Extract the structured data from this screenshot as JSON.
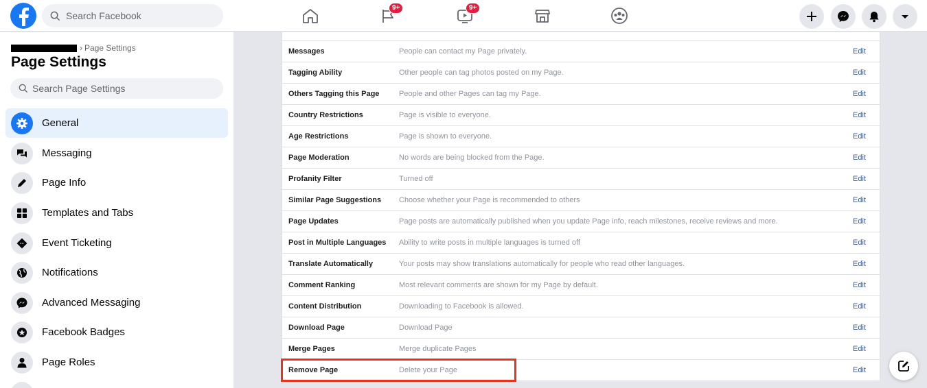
{
  "topbar": {
    "search_placeholder": "Search Facebook",
    "nav": [
      {
        "name": "home",
        "badge": ""
      },
      {
        "name": "pages",
        "badge": "9+"
      },
      {
        "name": "watch",
        "badge": "9+"
      },
      {
        "name": "marketplace",
        "badge": ""
      },
      {
        "name": "groups",
        "badge": ""
      }
    ]
  },
  "sidebar": {
    "breadcrumb": "Page Settings",
    "title": "Page Settings",
    "search_placeholder": "Search Page Settings",
    "items": [
      {
        "label": "General",
        "icon": "gear-icon",
        "active": true
      },
      {
        "label": "Messaging",
        "icon": "chat-icon"
      },
      {
        "label": "Page Info",
        "icon": "pencil-icon"
      },
      {
        "label": "Templates and Tabs",
        "icon": "grid-icon"
      },
      {
        "label": "Event Ticketing",
        "icon": "ticket-icon"
      },
      {
        "label": "Notifications",
        "icon": "globe-icon"
      },
      {
        "label": "Advanced Messaging",
        "icon": "messenger-icon"
      },
      {
        "label": "Facebook Badges",
        "icon": "badge-icon"
      },
      {
        "label": "Page Roles",
        "icon": "person-icon"
      }
    ]
  },
  "settings": {
    "edit_label": "Edit",
    "rows": [
      {
        "label": "Messages",
        "desc": "People can contact my Page privately."
      },
      {
        "label": "Tagging Ability",
        "desc": "Other people can tag photos posted on my Page."
      },
      {
        "label": "Others Tagging this Page",
        "desc": "People and other Pages can tag my Page."
      },
      {
        "label": "Country Restrictions",
        "desc": "Page is visible to everyone."
      },
      {
        "label": "Age Restrictions",
        "desc": "Page is shown to everyone."
      },
      {
        "label": "Page Moderation",
        "desc": "No words are being blocked from the Page."
      },
      {
        "label": "Profanity Filter",
        "desc": "Turned off"
      },
      {
        "label": "Similar Page Suggestions",
        "desc": "Choose whether your Page is recommended to others"
      },
      {
        "label": "Page Updates",
        "desc": "Page posts are automatically published when you update Page info, reach milestones, receive reviews and more."
      },
      {
        "label": "Post in Multiple Languages",
        "desc": "Ability to write posts in multiple languages is turned off"
      },
      {
        "label": "Translate Automatically",
        "desc": "Your posts may show translations automatically for people who read other languages."
      },
      {
        "label": "Comment Ranking",
        "desc": "Most relevant comments are shown for my Page by default."
      },
      {
        "label": "Content Distribution",
        "desc": "Downloading to Facebook is allowed."
      },
      {
        "label": "Download Page",
        "desc": "Download Page"
      },
      {
        "label": "Merge Pages",
        "desc": "Merge duplicate Pages"
      },
      {
        "label": "Remove Page",
        "desc": "Delete your Page"
      }
    ]
  },
  "colors": {
    "brand": "#1877f2",
    "badge": "#e41e3f",
    "highlight": "#e4341e",
    "link": "#385898"
  }
}
